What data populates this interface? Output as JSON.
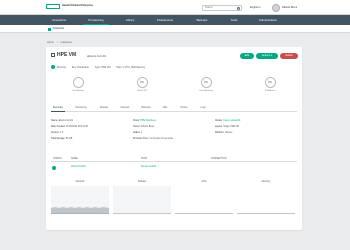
{
  "header": {
    "logo_text": "Hewlett Packard Enterprise",
    "search_placeholder": "Search",
    "language": "English",
    "user_name": "Alberto Bruni"
  },
  "nav": {
    "items": [
      {
        "label": "Operations"
      },
      {
        "label": "Provisioning"
      },
      {
        "label": "Library"
      },
      {
        "label": "Infrastructure"
      },
      {
        "label": "Backups"
      },
      {
        "label": "Tools"
      },
      {
        "label": "Administration"
      }
    ]
  },
  "subnav": {
    "label": "Instances"
  },
  "breadcrumb": [
    "Home",
    "Instances"
  ],
  "vm": {
    "title": "HPE VM",
    "name": "alberto-hvm01",
    "status": "Running",
    "environment": "Env: Production",
    "type": "Type: HPE VM",
    "plan": "Plan: 1 CPU, 8GB Memory"
  },
  "buttons": {
    "edit": "Edit",
    "actions": "Actions ▾",
    "delete": "Delete"
  },
  "stats": [
    {
      "value": "",
      "label": "Last Backup"
    },
    {
      "value": "0%",
      "label": "Used CPU"
    },
    {
      "value": "0%",
      "label": "Used Memory"
    },
    {
      "value": "0%",
      "label": "IP Address"
    }
  ],
  "tabs": [
    "Summary",
    "Monitoring",
    "Storage",
    "Network",
    "Backups",
    "Wiki",
    "History",
    "Logs"
  ],
  "properties": [
    {
      "k": "Name:",
      "v": "alberto-hvm01"
    },
    {
      "k": "Cloud:",
      "v": "HPE Morpheus",
      "link": true
    },
    {
      "k": "Cluster:",
      "v": "hpevm-cluster01",
      "link": true
    },
    {
      "k": "Date Created:",
      "v": "11/15/2024 08:14 PM"
    },
    {
      "k": "Owner:",
      "v": "Alberto Bruni"
    },
    {
      "k": "Layout:",
      "v": "Single HPE VM"
    },
    {
      "k": "Version:",
      "v": "1.0"
    },
    {
      "k": "Nodes:",
      "v": "1"
    },
    {
      "k": "Platform:",
      "v": "Ubuntu"
    },
    {
      "k": "Total Storage:",
      "v": "50 GB"
    },
    {
      "k": "Provision Time:",
      "v": "11 minutes 10 seconds"
    }
  ],
  "hw_table": {
    "headers": [
      "STATUS",
      "NAME",
      "HOST",
      "CONNECTION"
    ],
    "row": {
      "name": "alberto-hvm01",
      "host": "hpevm-node01"
    }
  },
  "charts": [
    "Network",
    "Storage",
    "CPU",
    "Memory"
  ],
  "colors": {
    "accent": "#01a982",
    "nav": "#425563",
    "danger": "#c54e4b"
  }
}
